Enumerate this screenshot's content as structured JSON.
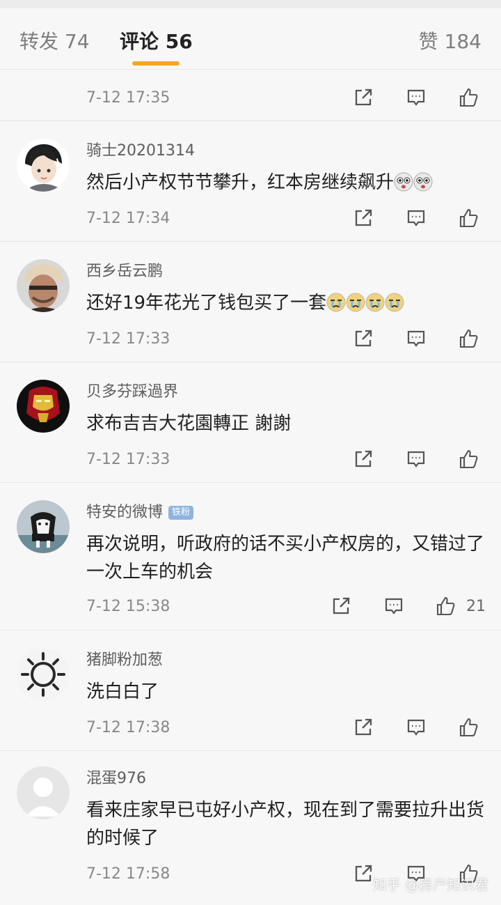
{
  "tabs": {
    "repost": "转发 74",
    "comments": "评论 56",
    "likes": "赞 184"
  },
  "comments": [
    {
      "username": "",
      "content": "",
      "time": "7-12 17:35",
      "like_count": ""
    },
    {
      "username": "骑士20201314",
      "content": "然后小产权节节攀升，红本房继续飙升",
      "emoji_count": 2,
      "time": "7-12 17:34",
      "like_count": ""
    },
    {
      "username": "西乡岳云鹏",
      "content": "还好19年花光了钱包买了一套",
      "emoji_count": 4,
      "time": "7-12 17:33",
      "like_count": ""
    },
    {
      "username": "贝多芬踩過界",
      "content": "求布吉吉大花園轉正 謝謝",
      "time": "7-12 17:33",
      "like_count": ""
    },
    {
      "username": "特安的微博",
      "badge": "铁粉",
      "content": "再次说明，听政府的话不买小产权房的，又错过了一次上车的机会",
      "time": "7-12 15:38",
      "like_count": "21"
    },
    {
      "username": "猪脚粉加葱",
      "content": "洗白白了",
      "time": "7-12 17:38",
      "like_count": ""
    },
    {
      "username": "混蛋976",
      "content": "看来庄家早已屯好小产权，现在到了需要拉升出货的时候了",
      "time": "7-12 17:58",
      "like_count": ""
    }
  ],
  "icons": {
    "repost": "share-icon",
    "reply": "comment-icon",
    "like": "thumbs-up-icon"
  },
  "watermark": "知乎 @房产知识君",
  "colors": {
    "accent": "#f5a623",
    "badge": "#8fb4e0"
  }
}
